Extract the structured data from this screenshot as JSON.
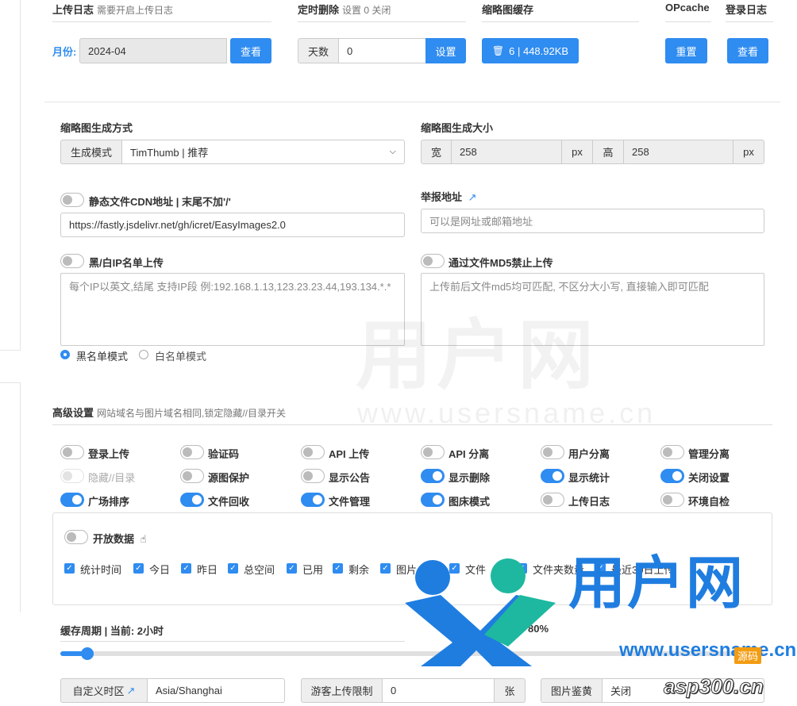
{
  "top": {
    "upload_log": {
      "title": "上传日志",
      "sub": "需要开启上传日志",
      "month_label": "月份:",
      "month_value": "2024-04",
      "button": "查看"
    },
    "timed_delete": {
      "title": "定时删除",
      "sub": "设置 0 关闭",
      "addon": "天数",
      "value": "0",
      "button": "设置"
    },
    "thumb_cache": {
      "title": "缩略图缓存",
      "button": "6 | 448.92KB"
    },
    "opcache": {
      "title": "OPcache",
      "button": "重置"
    },
    "login_log": {
      "title": "登录日志",
      "button": "查看"
    }
  },
  "thumb_mode": {
    "title": "缩略图生成方式",
    "addon": "生成模式",
    "selected": "TimThumb | 推荐"
  },
  "thumb_size": {
    "title": "缩略图生成大小",
    "w_label": "宽",
    "w_value": "258",
    "w_unit": "px",
    "h_label": "高",
    "h_value": "258",
    "h_unit": "px"
  },
  "cdn": {
    "label": "静态文件CDN地址 | 末尾不加'/'",
    "value": "https://fastly.jsdelivr.net/gh/icret/EasyImages2.0"
  },
  "report": {
    "label": "举报地址",
    "placeholder": "可以是网址或邮箱地址"
  },
  "ip_list": {
    "label": "黑/白IP名单上传",
    "placeholder": "每个IP以英文,结尾 支持IP段 例:192.168.1.13,123.23.23.44,193.134.*.*",
    "radio_black": "黑名单模式",
    "radio_white": "白名单模式"
  },
  "md5": {
    "label": "通过文件MD5禁止上传",
    "placeholder": "上传前后文件md5均可匹配, 不区分大小写, 直接输入即可匹配"
  },
  "advanced": {
    "title": "高级设置",
    "sub": "网站域名与图片域名相同,锁定隐藏//目录开关"
  },
  "switches": [
    {
      "label": "登录上传",
      "on": false
    },
    {
      "label": "验证码",
      "on": false
    },
    {
      "label": "API 上传",
      "on": false
    },
    {
      "label": "API 分离",
      "on": false
    },
    {
      "label": "用户分离",
      "on": false
    },
    {
      "label": "管理分离",
      "on": false
    },
    {
      "label": "隐藏//目录",
      "on": false,
      "disabled": true
    },
    {
      "label": "源图保护",
      "on": false
    },
    {
      "label": "显示公告",
      "on": false
    },
    {
      "label": "显示删除",
      "on": true
    },
    {
      "label": "显示统计",
      "on": true
    },
    {
      "label": "关闭设置",
      "on": true
    },
    {
      "label": "广场排序",
      "on": true
    },
    {
      "label": "文件回收",
      "on": true
    },
    {
      "label": "文件管理",
      "on": true
    },
    {
      "label": "图床模式",
      "on": true
    },
    {
      "label": "上传日志",
      "on": false
    },
    {
      "label": "环境自检",
      "on": false
    }
  ],
  "open_data": {
    "label": "开放数据",
    "checks": [
      "统计时间",
      "今日",
      "昨日",
      "总空间",
      "已用",
      "剩余",
      "图片占用",
      "文件",
      "文件夹数量",
      "最近30日上传"
    ]
  },
  "cache": {
    "label": "缓存周期 | 当前: 2小时",
    "right_text": "80%"
  },
  "bottom": {
    "timezone": {
      "label": "自定义时区",
      "value": "Asia/Shanghai"
    },
    "guest_limit": {
      "label": "游客上传限制",
      "value": "0",
      "unit": "张"
    },
    "review": {
      "label": "图片鉴黄",
      "value": "关闭"
    }
  },
  "watermark": {
    "brand": "用户网",
    "url": "www.usersname.cn",
    "site": "asp300.cn",
    "badge": "源码"
  },
  "colors": {
    "primary": "#2f8cf0",
    "watermark_blue": "#1f7de0",
    "watermark_teal": "#1eb8a0"
  }
}
